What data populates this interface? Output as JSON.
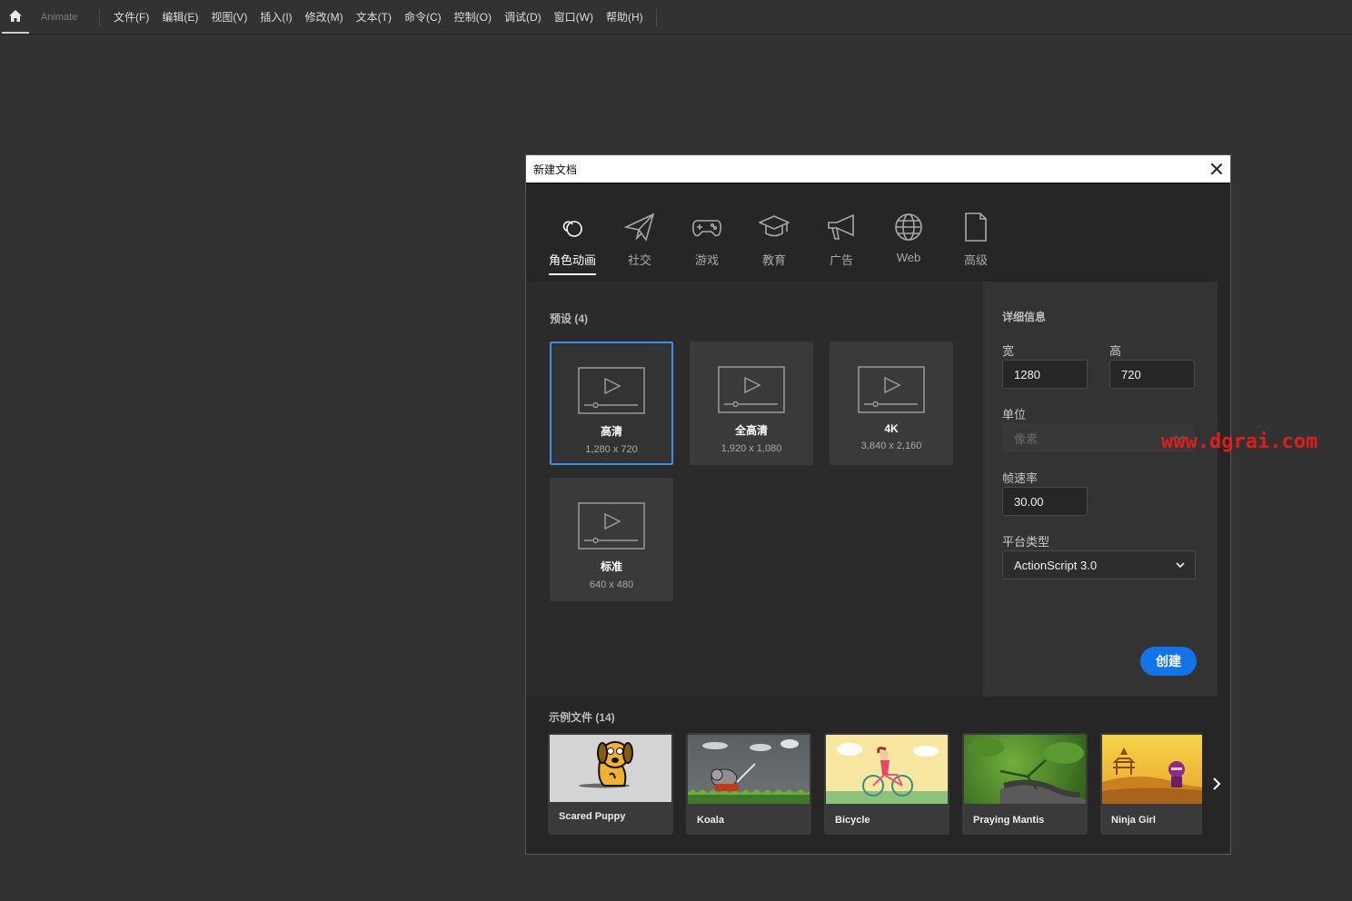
{
  "menubar": {
    "app_name": "Animate",
    "items": [
      "文件(F)",
      "编辑(E)",
      "视图(V)",
      "插入(I)",
      "修改(M)",
      "文本(T)",
      "命令(C)",
      "控制(O)",
      "调试(D)",
      "窗口(W)",
      "帮助(H)"
    ]
  },
  "dialog": {
    "title": "新建文档",
    "categories": [
      {
        "label": "角色动画",
        "icon": "character-animation-icon",
        "active": true
      },
      {
        "label": "社交",
        "icon": "paper-plane-icon"
      },
      {
        "label": "游戏",
        "icon": "gamepad-icon"
      },
      {
        "label": "教育",
        "icon": "graduation-cap-icon"
      },
      {
        "label": "广告",
        "icon": "megaphone-icon"
      },
      {
        "label": "Web",
        "icon": "globe-icon"
      },
      {
        "label": "高级",
        "icon": "document-icon"
      }
    ],
    "presets_title": "预设 (4)",
    "presets": [
      {
        "name": "高清",
        "size": "1,280 x 720",
        "selected": true
      },
      {
        "name": "全高清",
        "size": "1,920 x 1,080"
      },
      {
        "name": "4K",
        "size": "3,840 x 2,160"
      },
      {
        "name": "标准",
        "size": "640 x 480"
      }
    ],
    "details": {
      "title": "详细信息",
      "width_label": "宽",
      "width_value": "1280",
      "height_label": "高",
      "height_value": "720",
      "unit_label": "单位",
      "unit_value": "像素",
      "fps_label": "帧速率",
      "fps_value": "30.00",
      "platform_label": "平台类型",
      "platform_value": "ActionScript 3.0",
      "create_label": "创建"
    },
    "samples_title": "示例文件 (14)",
    "samples": [
      "Scared Puppy",
      "Koala",
      "Bicycle",
      "Praying Mantis",
      "Ninja Girl"
    ]
  },
  "watermark": "www.dgrai.com",
  "colors": {
    "accent": "#1473e6",
    "selected_border": "#3d8ee6",
    "watermark": "#e01d1d"
  }
}
